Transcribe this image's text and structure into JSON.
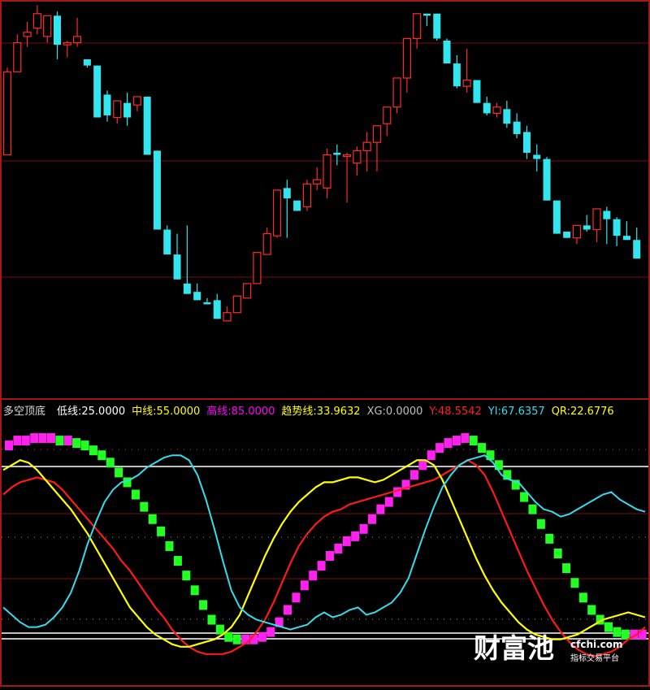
{
  "indicator": {
    "name": "多空顶底",
    "fields": [
      {
        "label": "低线:25.0000",
        "color": "#ffffff"
      },
      {
        "label": "中线:55.0000",
        "color": "#ffff00"
      },
      {
        "label": "高线:85.0000",
        "color": "#ff00ff"
      },
      {
        "label": "趋势线:33.9632",
        "color": "#ffff00"
      },
      {
        "label": "XG:0.0000",
        "color": "#c0c0c0"
      },
      {
        "label": "Y:48.5542",
        "color": "#ff2020"
      },
      {
        "label": "YI:67.6357",
        "color": "#33ddee"
      },
      {
        "label": "QR:22.6776",
        "color": "#ffff00"
      }
    ]
  },
  "watermark": {
    "brand": "财富池",
    "site": "cfchi.com",
    "slogan": "指标交易平台"
  },
  "colors": {
    "up": "#ff2a2a",
    "down": "#33e5ee",
    "red": "#ff1a1a",
    "yellow": "#ffff00",
    "cyan": "#33ddee",
    "magenta": "#ff22ee",
    "green": "#22ff22",
    "white": "#ffffff",
    "border": "#a01818"
  },
  "chart_data": [
    {
      "type": "candlestick",
      "ylim": [
        0,
        100
      ],
      "candles": [
        {
          "o": 22,
          "h": 64,
          "l": 22,
          "c": 62
        },
        {
          "o": 62,
          "h": 80,
          "l": 62,
          "c": 76
        },
        {
          "o": 79,
          "h": 86,
          "l": 74,
          "c": 81
        },
        {
          "o": 83,
          "h": 94,
          "l": 80,
          "c": 90
        },
        {
          "o": 79,
          "h": 89,
          "l": 76,
          "c": 89
        },
        {
          "o": 89,
          "h": 91,
          "l": 68,
          "c": 75
        },
        {
          "o": 75,
          "h": 77,
          "l": 69,
          "c": 76
        },
        {
          "o": 76,
          "h": 88,
          "l": 74,
          "c": 79
        },
        {
          "o": 68,
          "h": 67,
          "l": 64,
          "c": 65
        },
        {
          "o": 65,
          "h": 54,
          "l": 52,
          "c": 40
        },
        {
          "o": 51,
          "h": 53,
          "l": 38,
          "c": 41
        },
        {
          "o": 40,
          "h": 48,
          "l": 37,
          "c": 48
        },
        {
          "o": 47,
          "h": 52,
          "l": 36,
          "c": 40
        },
        {
          "o": 46,
          "h": 46,
          "l": 43,
          "c": 50
        },
        {
          "o": 50,
          "h": 47,
          "l": 35,
          "c": 22
        },
        {
          "o": 24,
          "h": 24,
          "l": 20,
          "c": -14
        },
        {
          "o": -14,
          "h": -12,
          "l": -8,
          "c": -26
        },
        {
          "o": -26,
          "h": -16,
          "l": -24,
          "c": -38
        },
        {
          "o": -40,
          "h": -12,
          "l": -43,
          "c": -45
        },
        {
          "o": -44,
          "h": -40,
          "l": -46,
          "c": -48
        },
        {
          "o": -49,
          "h": -47,
          "l": -50,
          "c": -50
        },
        {
          "o": -48,
          "h": -45,
          "l": -54,
          "c": -57
        },
        {
          "o": -58,
          "h": -51,
          "l": -58,
          "c": -54
        },
        {
          "o": -54,
          "h": -50,
          "l": -54,
          "c": -46
        },
        {
          "o": -47,
          "h": -40,
          "l": -39,
          "c": -40
        },
        {
          "o": -40,
          "h": -34,
          "l": -34,
          "c": -25
        },
        {
          "o": -26,
          "h": -13,
          "l": -20,
          "c": -16
        },
        {
          "o": -17,
          "h": 5,
          "l": -18,
          "c": 5
        },
        {
          "o": 6,
          "h": 10,
          "l": -18,
          "c": 1
        },
        {
          "o": 0,
          "h": 0,
          "l": 1,
          "c": -5
        },
        {
          "o": -3,
          "h": 10,
          "l": -5,
          "c": 8
        },
        {
          "o": 8,
          "h": 16,
          "l": 5,
          "c": 10
        },
        {
          "o": 6,
          "h": 25,
          "l": 1,
          "c": 22
        },
        {
          "o": 23,
          "h": 27,
          "l": 17,
          "c": 22
        },
        {
          "o": 22,
          "h": 23,
          "l": -1,
          "c": 22
        },
        {
          "o": 18,
          "h": 26,
          "l": 12,
          "c": 24
        },
        {
          "o": 24,
          "h": 33,
          "l": 14,
          "c": 28
        },
        {
          "o": 28,
          "h": 35,
          "l": 14,
          "c": 36
        },
        {
          "o": 37,
          "h": 43,
          "l": 31,
          "c": 45
        },
        {
          "o": 45,
          "h": 58,
          "l": 42,
          "c": 59
        },
        {
          "o": 59,
          "h": 72,
          "l": 52,
          "c": 78
        },
        {
          "o": 78,
          "h": 84,
          "l": 73,
          "c": 90
        },
        {
          "o": 90,
          "h": 85,
          "l": 84,
          "c": 89
        },
        {
          "o": 90,
          "h": 87,
          "l": 77,
          "c": 78
        },
        {
          "o": 77,
          "h": 78,
          "l": 66,
          "c": 66
        },
        {
          "o": 66,
          "h": 70,
          "l": 54,
          "c": 55
        },
        {
          "o": 55,
          "h": 73,
          "l": 52,
          "c": 58
        },
        {
          "o": 58,
          "h": 55,
          "l": 52,
          "c": 47
        },
        {
          "o": 47,
          "h": 50,
          "l": 41,
          "c": 42
        },
        {
          "o": 42,
          "h": 47,
          "l": 40,
          "c": 45
        },
        {
          "o": 44,
          "h": 48,
          "l": 35,
          "c": 37
        },
        {
          "o": 38,
          "h": 42,
          "l": 30,
          "c": 32
        },
        {
          "o": 33,
          "h": 36,
          "l": 20,
          "c": 23
        },
        {
          "o": 22,
          "h": 27,
          "l": 14,
          "c": 20
        },
        {
          "o": 20,
          "h": 21,
          "l": 6,
          "c": 0
        },
        {
          "o": 0,
          "h": -1,
          "l": -3,
          "c": -16
        },
        {
          "o": -15,
          "h": -17,
          "l": -18,
          "c": -18
        },
        {
          "o": -18,
          "h": -16,
          "l": -21,
          "c": -12
        },
        {
          "o": -12,
          "h": -7,
          "l": -15,
          "c": -14
        },
        {
          "o": -14,
          "h": -12,
          "l": -20,
          "c": -4
        },
        {
          "o": -5,
          "h": -3,
          "l": -21,
          "c": -9
        },
        {
          "o": -9,
          "h": -8,
          "l": -22,
          "c": -17
        },
        {
          "o": -17,
          "h": -10,
          "l": -17,
          "c": -19
        },
        {
          "o": -19,
          "h": -13,
          "l": -21,
          "c": -28
        }
      ]
    },
    {
      "type": "line",
      "ylim": [
        0,
        100
      ],
      "reference_lines": [
        {
          "name": "低线",
          "value": 25
        },
        {
          "name": "中线",
          "value": 55
        },
        {
          "name": "高线",
          "value": 85
        }
      ],
      "series": [
        {
          "name": "Y",
          "color": "#ff1a1a",
          "values": [
            74,
            77,
            79,
            80,
            81,
            80,
            79,
            76,
            72,
            68,
            64,
            60,
            56,
            52,
            47,
            43,
            38,
            33,
            28,
            24,
            19,
            15,
            12,
            10,
            9,
            9,
            9,
            10,
            12,
            14,
            18,
            23,
            30,
            38,
            46,
            53,
            58,
            62,
            65,
            67,
            68,
            70,
            71,
            72,
            73,
            74,
            75,
            76,
            77,
            78,
            79,
            80,
            82,
            84,
            86,
            88,
            86,
            82,
            75,
            67,
            59,
            51,
            43,
            36,
            29,
            23,
            18,
            14,
            11,
            9,
            8,
            9,
            10,
            12,
            15,
            17,
            20
          ]
        },
        {
          "name": "趋势线",
          "color": "#ffff00",
          "values": [
            84,
            86,
            88,
            87,
            84,
            80,
            76,
            72,
            68,
            63,
            58,
            52,
            46,
            40,
            34,
            28,
            24,
            20,
            17,
            15,
            13,
            12,
            12,
            13,
            14,
            15,
            17,
            20,
            25,
            33,
            41,
            49,
            56,
            62,
            67,
            71,
            74,
            77,
            79,
            79,
            80,
            81,
            81,
            80,
            79,
            80,
            82,
            84,
            86,
            88,
            88,
            86,
            80,
            72,
            64,
            56,
            48,
            41,
            35,
            30,
            26,
            22,
            19,
            17,
            16,
            15,
            15,
            16,
            17,
            19,
            21,
            23,
            24,
            25,
            26,
            25,
            24
          ]
        },
        {
          "name": "YI",
          "color": "#33ddee",
          "values": [
            28,
            25,
            22,
            20,
            20,
            21,
            24,
            28,
            34,
            43,
            54,
            63,
            71,
            76,
            79,
            80,
            82,
            85,
            87,
            89,
            90,
            90,
            88,
            82,
            72,
            60,
            47,
            35,
            28,
            25,
            23,
            22,
            21,
            20,
            19,
            20,
            21,
            24,
            26,
            24,
            25,
            27,
            28,
            25,
            26,
            28,
            30,
            34,
            40,
            50,
            60,
            69,
            77,
            82,
            86,
            88,
            89,
            90,
            87,
            82,
            80,
            79,
            75,
            71,
            68,
            67,
            65,
            66,
            68,
            70,
            72,
            74,
            75,
            72,
            70,
            68,
            67
          ]
        }
      ],
      "bars": {
        "colors": {
          "rising": "#ff22ee",
          "falling": "#22ff22"
        },
        "values": [
          94,
          96,
          96,
          97,
          97,
          97,
          96,
          96,
          95,
          94,
          92,
          90,
          87,
          83,
          79,
          74,
          69,
          64,
          59,
          53,
          47,
          41,
          35,
          29,
          23,
          19,
          16,
          15,
          15,
          15,
          16,
          18,
          22,
          27,
          32,
          37,
          41,
          45,
          49,
          52,
          55,
          57,
          60,
          64,
          68,
          71,
          75,
          78,
          82,
          86,
          90,
          93,
          95,
          96,
          97,
          96,
          93,
          90,
          86,
          82,
          78,
          73,
          68,
          62,
          56,
          50,
          44,
          38,
          32,
          27,
          23,
          20,
          18,
          17,
          17,
          17
        ]
      }
    }
  ]
}
